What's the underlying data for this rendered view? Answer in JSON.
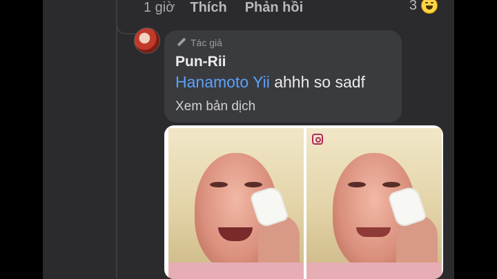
{
  "actions": {
    "time": "1 giờ",
    "like": "Thích",
    "reply": "Phản hồi",
    "reaction_count": "3"
  },
  "reply": {
    "author_tag": "Tác giả",
    "name": "Pun-Rii",
    "mention": "Hanamoto Yii",
    "text": " ahhh so sadf",
    "see_translation": "Xem bản dịch"
  },
  "image": {
    "watermark": ""
  },
  "icons": [
    "pencil-icon",
    "haha-reaction-icon",
    "instagram-icon"
  ],
  "colors": {
    "background": "#2b2b2d",
    "bubble": "#3a3b3e",
    "mention": "#5aa2ff"
  }
}
